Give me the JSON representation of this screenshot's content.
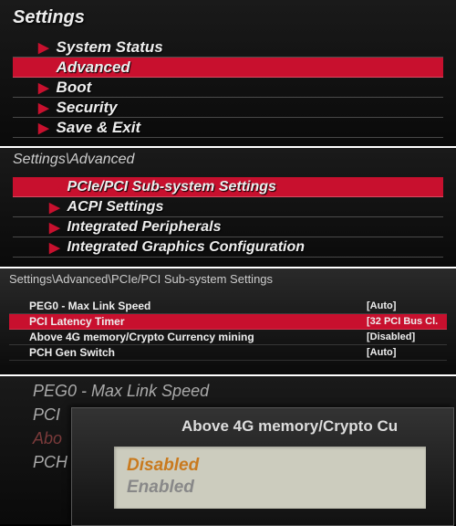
{
  "panel1": {
    "title": "Settings",
    "items": [
      {
        "label": "System Status",
        "selected": false
      },
      {
        "label": "Advanced",
        "selected": true
      },
      {
        "label": "Boot",
        "selected": false
      },
      {
        "label": "Security",
        "selected": false
      },
      {
        "label": "Save & Exit",
        "selected": false
      }
    ]
  },
  "panel2": {
    "breadcrumb": "Settings\\Advanced",
    "items": [
      {
        "label": "PCIe/PCI Sub-system Settings",
        "selected": true
      },
      {
        "label": "ACPI Settings",
        "selected": false
      },
      {
        "label": "Integrated Peripherals",
        "selected": false
      },
      {
        "label": "Integrated Graphics Configuration",
        "selected": false
      }
    ]
  },
  "panel3": {
    "breadcrumb": "Settings\\Advanced\\PCIe/PCI Sub-system Settings",
    "rows": [
      {
        "label": "PEG0 - Max Link Speed",
        "value": "[Auto]",
        "selected": false
      },
      {
        "label": "PCI Latency Timer",
        "value": "[32 PCI Bus Cl...]",
        "selected": true
      },
      {
        "label": "Above 4G memory/Crypto Currency mining",
        "value": "[Disabled]",
        "selected": false
      },
      {
        "label": "PCH Gen Switch",
        "value": "[Auto]",
        "selected": false
      }
    ]
  },
  "panel4": {
    "bg": [
      {
        "label": "PEG0 - Max Link Speed"
      },
      {
        "label": "PCI"
      },
      {
        "label": "Abo"
      },
      {
        "label": "PCH"
      }
    ],
    "popup": {
      "title": "Above 4G memory/Crypto Cu",
      "options": [
        {
          "label": "Disabled",
          "selected": true
        },
        {
          "label": "Enabled",
          "selected": false
        }
      ]
    }
  }
}
